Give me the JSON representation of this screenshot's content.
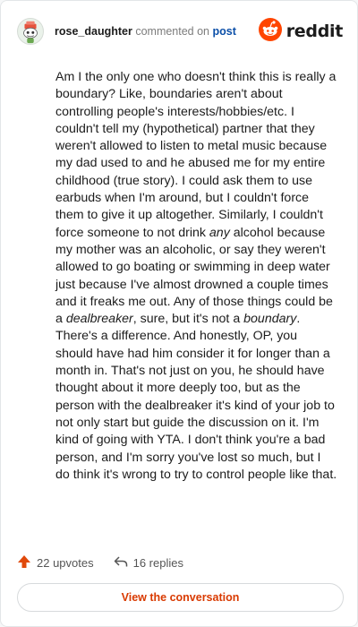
{
  "comment": {
    "username": "rose_daughter",
    "action_text": "commented on",
    "post_link": "post",
    "brand_name": "reddit",
    "body_paragraphs": [
      {
        "text": "Am I the only one who doesn't think this is really a boundary? Like, boundaries aren't about controlling people's interests/hobbies/etc. I couldn't tell my (hypothetical) partner that they weren't allowed to listen to metal music because my dad used to and he abused me for my entire childhood (true story). I could ask them to use earbuds when I'm around, but I couldn't force them to give it up altogether. Similarly, I couldn't force someone to not drink "
      },
      {
        "text": "any",
        "em": true
      },
      {
        "text": " alcohol because my mother was an alcoholic, or say they weren't allowed to go boating or swimming in deep water just because I've almost drowned a couple times and it freaks me out. Any of those things could be a "
      },
      {
        "text": "dealbreaker",
        "em": true
      },
      {
        "text": ", sure, but it's not a "
      },
      {
        "text": "boundary",
        "em": true
      },
      {
        "text": ". There's a difference. And honestly, OP, you should have had him consider it for longer than a month in. That's not just on you, he should have thought about it more deeply too, but as the person with the dealbreaker it's kind of your job to not only start but guide the discussion on it. I'm kind of going with YTA. I don't think you're a bad person, and I'm sorry you've lost so much, but I do think it's wrong to try to control people like that."
      }
    ],
    "upvotes": "22 upvotes",
    "replies": "16 replies",
    "cta_label": "View the conversation"
  },
  "icons": {
    "avatar": "snoo-avatar",
    "brand": "reddit-logo-icon",
    "upvote": "upvote-arrow-icon",
    "reply": "reply-arrow-icon"
  },
  "colors": {
    "brand_orange": "#ff4500",
    "link_blue": "#0b4fa8",
    "cta_text": "#d93a00",
    "upvote": "#e0490b"
  }
}
